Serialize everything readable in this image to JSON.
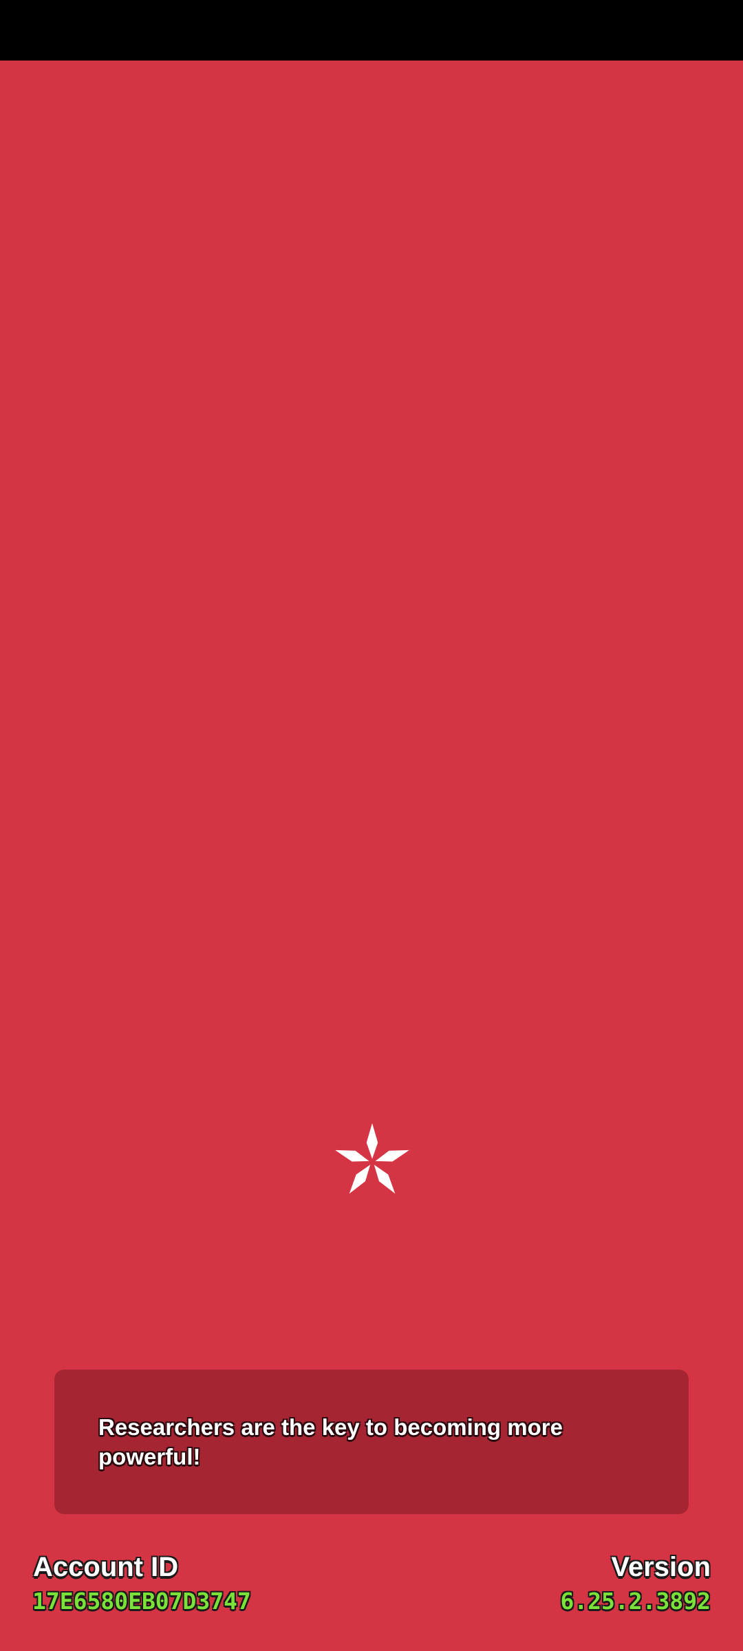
{
  "loading": {
    "spinner_icon": "white-star-spinner-icon",
    "tip": "Researchers are the key to becoming more powerful!"
  },
  "footer": {
    "account_label": "Account ID",
    "account_id": "17E6580EB07D3747",
    "version_label": "Version",
    "version": "6.25.2.3892"
  },
  "colors": {
    "background": "#d43443",
    "tip_box": "#a62533",
    "accent_green": "#7be23a",
    "status_bar": "#000000"
  }
}
